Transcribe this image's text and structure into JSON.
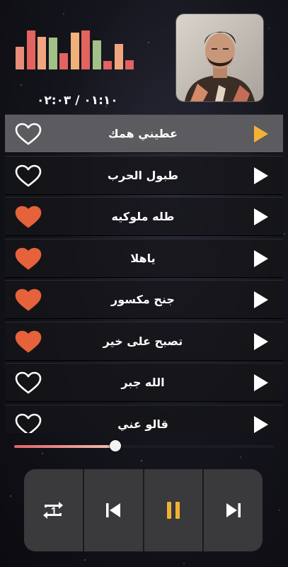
{
  "colors": {
    "accent": "#f2b134",
    "heart_filled": "#e5623a",
    "bar_colors": [
      "#e98c7a",
      "#e2635f",
      "#f0a57e",
      "#a3c089",
      "#e2635f",
      "#f0b07a",
      "#e2635f",
      "#a3c089",
      "#e2635f",
      "#f0a57e",
      "#e2635f"
    ]
  },
  "equalizer": {
    "levels": [
      0.55,
      0.95,
      0.8,
      0.78,
      0.4,
      0.9,
      0.95,
      0.7,
      0.2,
      0.62,
      0.22
    ]
  },
  "time": {
    "text": "٠١:١٠ / ٠٢:٠٣"
  },
  "avatar": {
    "icon": "artist-photo"
  },
  "songs": [
    {
      "title": "عطيني همك",
      "favorite": false,
      "active": true
    },
    {
      "title": "طبول الحرب",
      "favorite": false,
      "active": false
    },
    {
      "title": "طله ملوكيه",
      "favorite": true,
      "active": false
    },
    {
      "title": "ياهلا",
      "favorite": true,
      "active": false
    },
    {
      "title": "جنح مكسور",
      "favorite": true,
      "active": false
    },
    {
      "title": "تصبح على خير",
      "favorite": true,
      "active": false
    },
    {
      "title": "الله جبر",
      "favorite": false,
      "active": false
    },
    {
      "title": "قالو عني",
      "favorite": false,
      "active": false
    }
  ],
  "progress": {
    "fraction": 0.39
  },
  "controls": {
    "icons": [
      "repeat-one-icon",
      "previous-icon",
      "pause-icon",
      "next-icon"
    ]
  }
}
